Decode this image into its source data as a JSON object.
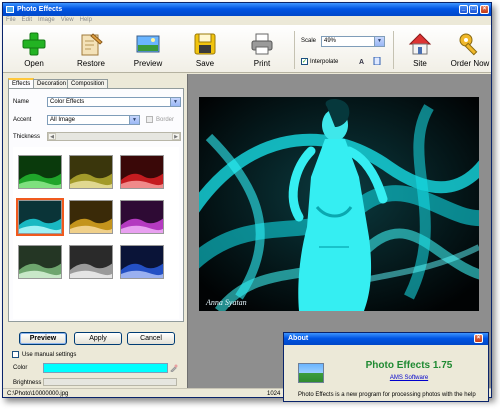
{
  "window": {
    "title": "Photo Effects"
  },
  "menu": [
    "File",
    "Edit",
    "Image",
    "View",
    "Help"
  ],
  "toolbar": {
    "open": "Open",
    "restore": "Restore",
    "preview": "Preview",
    "save": "Save",
    "print": "Print",
    "scale_label": "Scale",
    "scale_value": "49%",
    "interpolate_label": "Interpolate",
    "interpolate_checked": true,
    "site": "Site",
    "order": "Order Now"
  },
  "tabs": [
    "Effects",
    "Decoration",
    "Composition"
  ],
  "effects": {
    "name_label": "Name",
    "name_value": "Color Effects",
    "accent_label": "Accent",
    "accent_value": "All Image",
    "border_label": "Border",
    "thickness_label": "Thickness"
  },
  "presets": [
    {
      "color": "#1fa52a",
      "tint": "green"
    },
    {
      "color": "#a29a2a",
      "tint": "olive"
    },
    {
      "color": "#c41c20",
      "tint": "red"
    },
    {
      "color": "#19b8c2",
      "tint": "cyan"
    },
    {
      "color": "#c4941c",
      "tint": "orange"
    },
    {
      "color": "#b43ac0",
      "tint": "purple"
    },
    {
      "color": "#6ea56e",
      "tint": "sage"
    },
    {
      "color": "#9a9a9a",
      "tint": "gray"
    },
    {
      "color": "#2450c4",
      "tint": "blue"
    }
  ],
  "buttons": {
    "preview": "Preview",
    "apply": "Apply",
    "cancel": "Cancel"
  },
  "manual_settings_label": "Use manual settings",
  "color_label": "Color",
  "brightness_label": "Brightness",
  "color_value": "#00ffff",
  "photo_caption": "Anna Syatan",
  "status": {
    "path": "C:\\Photo\\10000000.jpg",
    "dims": "1024"
  },
  "about": {
    "title": "About",
    "heading": "Photo Effects 1.75",
    "link": "AMS Software",
    "text": "Photo Effects is a new program for processing photos with the help"
  }
}
